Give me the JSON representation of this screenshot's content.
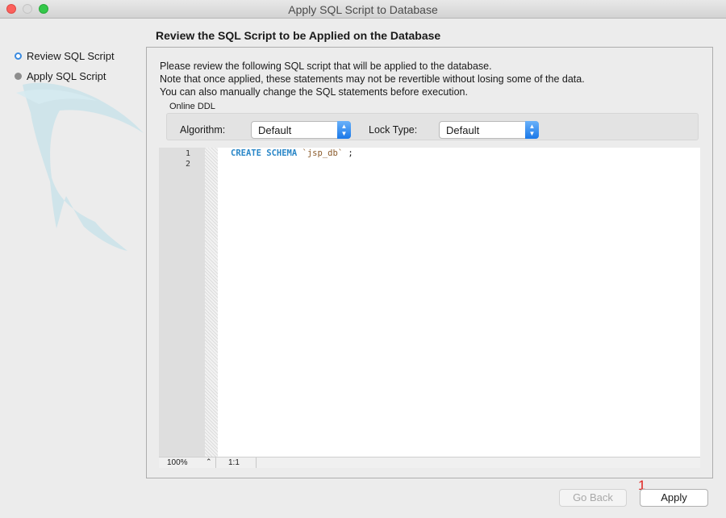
{
  "window": {
    "title": "Apply SQL Script to Database"
  },
  "steps": [
    {
      "label": "Review SQL Script"
    },
    {
      "label": "Apply SQL Script"
    }
  ],
  "page": {
    "title": "Review the SQL Script to be Applied on the Database",
    "description": [
      "Please review the following SQL script that will be applied to the database.",
      "Note that once applied, these statements may not be revertible without losing some of the data.",
      "You can also manually change the SQL statements before execution."
    ]
  },
  "online_ddl": {
    "label": "Online DDL",
    "algorithm_label": "Algorithm:",
    "algorithm_value": "Default",
    "lock_type_label": "Lock Type:",
    "lock_type_value": "Default"
  },
  "editor": {
    "line_numbers": [
      "1",
      "2"
    ],
    "code": {
      "keyword": "CREATE SCHEMA",
      "identifier": "`jsp_db`",
      "terminator": ";"
    },
    "zoom": "100%",
    "cursor_position": "1:1"
  },
  "buttons": {
    "go_back": "Go Back",
    "apply": "Apply"
  },
  "annotation_marker": "1",
  "colors": {
    "accent": "#1a78e8",
    "keyword": "#2a87c8",
    "identifier": "#8a5a2a",
    "marker": "#e0201c"
  }
}
